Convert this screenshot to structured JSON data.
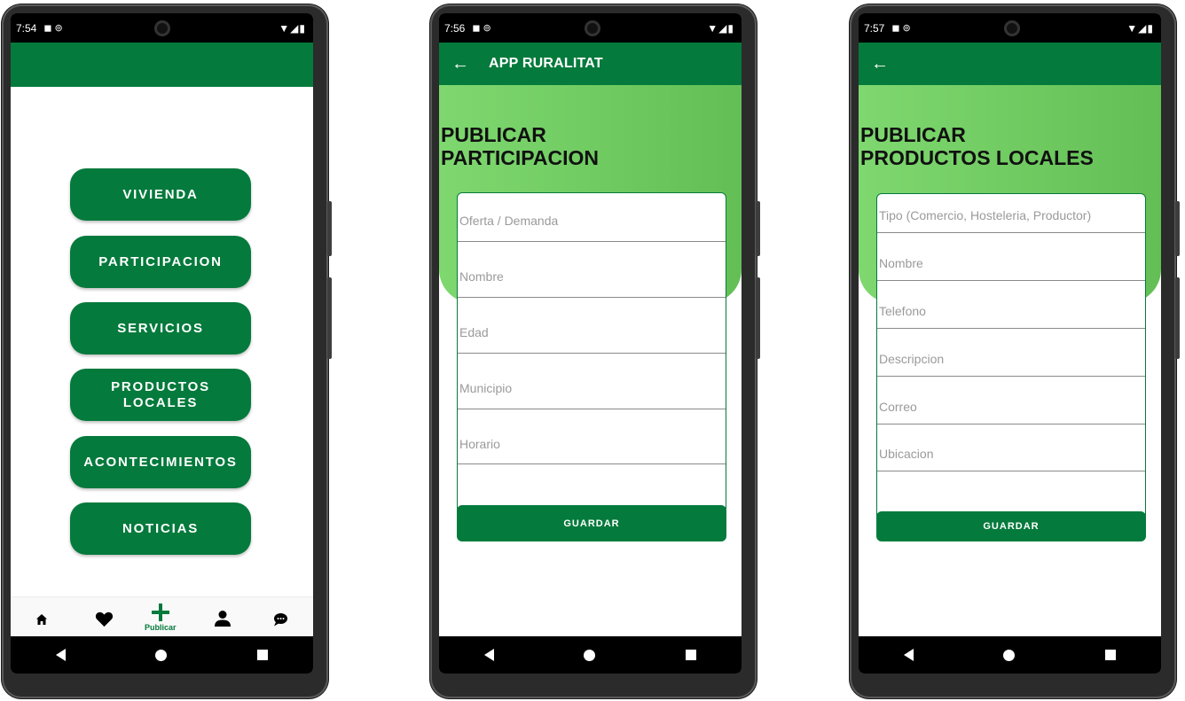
{
  "screens": [
    {
      "status": {
        "time": "7:54",
        "icons_left": "◼ ⊚",
        "icons_right": "▼◢▮"
      },
      "menu": [
        {
          "label": "VIVIENDA"
        },
        {
          "label": "PARTICIPACION"
        },
        {
          "label": "SERVICIOS"
        },
        {
          "label": "PRODUCTOS\nLOCALES"
        },
        {
          "label": "ACONTECIMIENTOS"
        },
        {
          "label": "NOTICIAS"
        }
      ],
      "bottom_nav": {
        "home_icon": "home-icon",
        "favorites_icon": "heart-icon",
        "publish_label": "Publicar",
        "profile_icon": "person-icon",
        "chat_icon": "chat-icon"
      }
    },
    {
      "status": {
        "time": "7:56",
        "icons_left": "◼ ⊚",
        "icons_right": "▼◢▮"
      },
      "appbar": {
        "back": "←",
        "title": "APP RURALITAT"
      },
      "hero_title": "PUBLICAR\nPARTICIPACION",
      "fields": [
        {
          "placeholder": "Oferta / Demanda"
        },
        {
          "placeholder": "Nombre"
        },
        {
          "placeholder": "Edad"
        },
        {
          "placeholder": "Municipio"
        },
        {
          "placeholder": "Horario"
        }
      ],
      "save_label": "GUARDAR"
    },
    {
      "status": {
        "time": "7:57",
        "icons_left": "◼ ⊚",
        "icons_right": "▼◢▮"
      },
      "appbar": {
        "back": "←",
        "title": ""
      },
      "hero_title": "PUBLICAR\nPRODUCTOS LOCALES",
      "fields": [
        {
          "placeholder": "Tipo (Comercio, Hosteleria, Productor)"
        },
        {
          "placeholder": "Nombre"
        },
        {
          "placeholder": "Telefono"
        },
        {
          "placeholder": "Descripcion"
        },
        {
          "placeholder": "Correo"
        },
        {
          "placeholder": "Ubicacion"
        }
      ],
      "save_label": "GUARDAR"
    }
  ],
  "colors": {
    "primary_green": "#047a3c",
    "hero_green_light": "#7ed86f",
    "hero_green_dark": "#63bf55"
  }
}
